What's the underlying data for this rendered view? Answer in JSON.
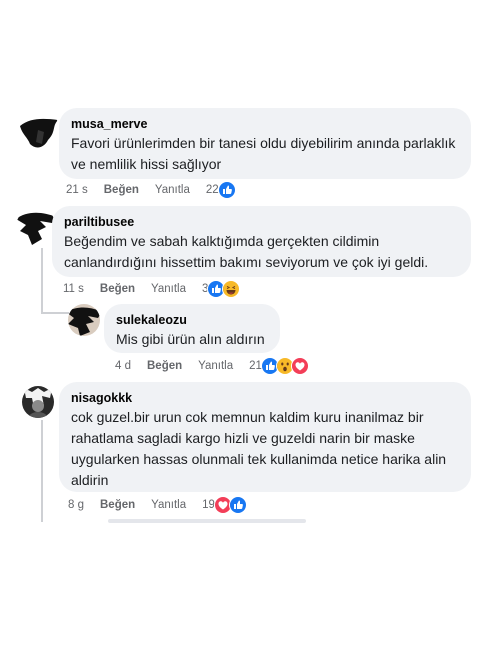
{
  "comments": [
    {
      "username": "musa_merve",
      "text": "Favori ürünlerimden bir tanesi oldu diyebilirim anında parlaklık ve nemlilik hissi sağlıyor",
      "time": "21 s",
      "like_label": "Beğen",
      "reply_label": "Yanıtla",
      "reaction_count": "22",
      "reactions": [
        "like"
      ]
    },
    {
      "username": "pariltibusee",
      "text": "Beğendim ve sabah kalktığımda gerçekten cildimin canlandırdığını hissettim bakımı seviyorum ve çok iyi geldi.",
      "time": "11 s",
      "like_label": "Beğen",
      "reply_label": "Yanıtla",
      "reaction_count": "3",
      "reactions": [
        "like",
        "haha"
      ],
      "replies": [
        {
          "username": "sulekaleozu",
          "text": "Mis gibi ürün alın aldırın",
          "time": "4 d",
          "like_label": "Beğen",
          "reply_label": "Yanıtla",
          "reaction_count": "21",
          "reactions": [
            "like",
            "wow",
            "love"
          ]
        }
      ]
    },
    {
      "username": "nisagokkk",
      "text": "cok guzel.bir urun cok memnun kaldim kuru inanilmaz bir rahatlama sagladi kargo hizli ve guzeldi narin bir maske uygularken hassas olunmali tek kullanimda netice harika alin aldirin",
      "time": "8 g",
      "like_label": "Beğen",
      "reply_label": "Yanıtla",
      "reaction_count": "19",
      "reactions": [
        "love",
        "like"
      ]
    }
  ],
  "colors": {
    "bubble": "#f0f2f5",
    "like_blue": "#1877f2",
    "love_red": "#f33e58",
    "haha_yellow": "#f7b928",
    "meta_gray": "#65676b"
  }
}
